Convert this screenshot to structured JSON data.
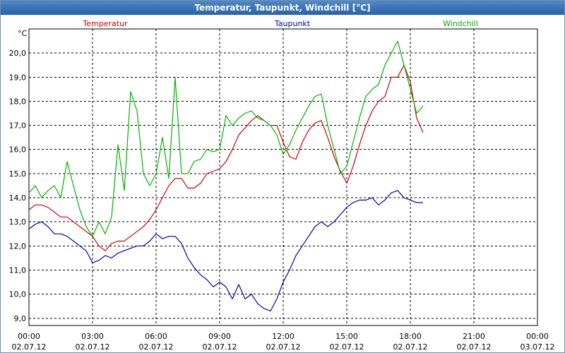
{
  "window": {
    "title": "Temperatur, Taupunkt, Windchill [°C]"
  },
  "chart_data": {
    "type": "line",
    "title": "Temperatur, Taupunkt, Windchill [°C]",
    "ylabel": "°C",
    "xlabel": "",
    "ylim": [
      8.7,
      21.0
    ],
    "yticks": [
      9.0,
      10.0,
      11.0,
      12.0,
      13.0,
      14.0,
      15.0,
      16.0,
      17.0,
      18.0,
      19.0,
      20.0
    ],
    "ytick_labels": [
      "9,0",
      "10,0",
      "11,0",
      "12,0",
      "13,0",
      "14,0",
      "15,0",
      "16,0",
      "17,0",
      "18,0",
      "19,0",
      "20,0"
    ],
    "xlim": [
      0,
      24
    ],
    "xticks": [
      0,
      3,
      6,
      9,
      12,
      15,
      18,
      21,
      24
    ],
    "xtick_labels": [
      [
        "00:00",
        "02.07.12"
      ],
      [
        "03:00",
        "02.07.12"
      ],
      [
        "06:00",
        "02.07.12"
      ],
      [
        "09:00",
        "02.07.12"
      ],
      [
        "12:00",
        "02.07.12"
      ],
      [
        "15:00",
        "02.07.12"
      ],
      [
        "18:00",
        "02.07.12"
      ],
      [
        "21:00",
        "02.07.12"
      ],
      [
        "00:00",
        "03.07.12"
      ]
    ],
    "x_unit": "hours since 02.07.12 00:00",
    "grid": true,
    "legend_position": "top",
    "series": [
      {
        "name": "Temperatur",
        "color": "#d40000",
        "x": [
          0,
          0.3,
          0.6,
          0.9,
          1.2,
          1.5,
          1.8,
          2.1,
          2.4,
          2.7,
          3.0,
          3.3,
          3.6,
          3.9,
          4.2,
          4.5,
          4.8,
          5.1,
          5.4,
          5.7,
          6.0,
          6.3,
          6.6,
          6.9,
          7.2,
          7.5,
          7.8,
          8.1,
          8.4,
          8.7,
          9.0,
          9.3,
          9.6,
          9.9,
          10.2,
          10.5,
          10.8,
          11.1,
          11.4,
          11.7,
          12.0,
          12.3,
          12.6,
          12.9,
          13.2,
          13.5,
          13.8,
          14.1,
          14.4,
          14.7,
          15.0,
          15.3,
          15.6,
          15.9,
          16.2,
          16.5,
          16.8,
          17.1,
          17.4,
          17.7,
          18.0,
          18.3,
          18.6
        ],
        "y": [
          13.5,
          13.7,
          13.7,
          13.6,
          13.4,
          13.2,
          13.2,
          13.0,
          12.8,
          12.6,
          12.4,
          12.0,
          11.8,
          12.1,
          12.2,
          12.2,
          12.4,
          12.6,
          12.8,
          13.1,
          13.5,
          14.0,
          14.5,
          14.8,
          14.8,
          14.4,
          14.4,
          14.6,
          15.0,
          15.1,
          15.2,
          15.5,
          16.0,
          16.6,
          16.9,
          17.2,
          17.4,
          17.2,
          17.0,
          17.0,
          16.3,
          15.7,
          15.6,
          16.3,
          16.8,
          17.1,
          17.2,
          16.5,
          15.7,
          15.1,
          14.6,
          15.3,
          16.2,
          17.0,
          17.6,
          18.0,
          18.2,
          19.0,
          19.0,
          19.5,
          18.8,
          17.3,
          16.7
        ]
      },
      {
        "name": "Taupunkt",
        "color": "#0000b4",
        "x": [
          0,
          0.3,
          0.6,
          0.9,
          1.2,
          1.5,
          1.8,
          2.1,
          2.4,
          2.7,
          3.0,
          3.3,
          3.6,
          3.9,
          4.2,
          4.5,
          4.8,
          5.1,
          5.4,
          5.7,
          6.0,
          6.3,
          6.6,
          6.9,
          7.2,
          7.5,
          7.8,
          8.1,
          8.4,
          8.7,
          9.0,
          9.3,
          9.6,
          9.9,
          10.2,
          10.5,
          10.8,
          11.1,
          11.4,
          11.7,
          12.0,
          12.3,
          12.6,
          12.9,
          13.2,
          13.5,
          13.8,
          14.1,
          14.4,
          14.7,
          15.0,
          15.3,
          15.6,
          15.9,
          16.2,
          16.5,
          16.8,
          17.1,
          17.4,
          17.7,
          18.0,
          18.3,
          18.6
        ],
        "y": [
          12.7,
          12.9,
          13.0,
          12.8,
          12.5,
          12.5,
          12.4,
          12.2,
          12.0,
          11.8,
          11.3,
          11.4,
          11.6,
          11.5,
          11.7,
          11.8,
          11.9,
          12.0,
          12.0,
          12.2,
          12.5,
          12.3,
          12.4,
          12.4,
          12.1,
          11.5,
          11.1,
          10.8,
          10.6,
          10.3,
          10.5,
          10.3,
          9.8,
          10.4,
          9.8,
          10.0,
          9.6,
          9.4,
          9.3,
          9.8,
          10.5,
          11.0,
          11.6,
          12.0,
          12.4,
          12.8,
          13.0,
          12.8,
          13.0,
          13.3,
          13.6,
          13.8,
          13.9,
          13.9,
          14.0,
          13.7,
          13.9,
          14.2,
          14.3,
          14.0,
          13.9,
          13.8,
          13.8
        ]
      },
      {
        "name": "Windchill",
        "color": "#00b400",
        "x": [
          0,
          0.3,
          0.6,
          0.9,
          1.2,
          1.5,
          1.8,
          2.1,
          2.4,
          2.7,
          3.0,
          3.3,
          3.6,
          3.9,
          4.2,
          4.5,
          4.8,
          5.1,
          5.4,
          5.7,
          6.0,
          6.3,
          6.6,
          6.9,
          7.2,
          7.5,
          7.8,
          8.1,
          8.4,
          8.7,
          9.0,
          9.3,
          9.6,
          9.9,
          10.2,
          10.5,
          10.8,
          11.1,
          11.4,
          11.7,
          12.0,
          12.3,
          12.6,
          12.9,
          13.2,
          13.5,
          13.8,
          14.1,
          14.4,
          14.7,
          15.0,
          15.3,
          15.6,
          15.9,
          16.2,
          16.5,
          16.8,
          17.1,
          17.4,
          17.7,
          18.0,
          18.3,
          18.6
        ],
        "y": [
          14.2,
          14.5,
          14.0,
          14.3,
          14.5,
          14.0,
          15.5,
          14.5,
          13.5,
          12.8,
          12.4,
          13.0,
          12.5,
          13.2,
          16.2,
          14.3,
          18.4,
          17.6,
          15.0,
          14.5,
          15.0,
          16.5,
          14.8,
          19.0,
          15.0,
          15.0,
          15.5,
          15.6,
          16.0,
          15.9,
          16.0,
          17.4,
          17.0,
          17.3,
          17.5,
          17.6,
          17.3,
          17.2,
          17.0,
          16.6,
          15.8,
          16.2,
          16.8,
          17.3,
          17.8,
          18.2,
          18.3,
          17.0,
          16.0,
          15.0,
          15.3,
          16.3,
          17.3,
          18.2,
          18.5,
          18.7,
          19.5,
          20.0,
          20.5,
          19.5,
          18.5,
          17.5,
          17.8
        ]
      }
    ]
  }
}
